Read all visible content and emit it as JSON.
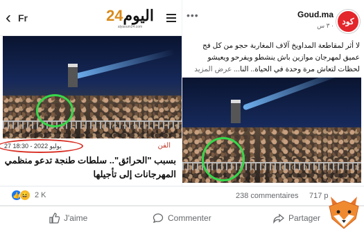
{
  "left_article": {
    "nav": {
      "back_icon": "chevron-left-icon",
      "lang": "Fr",
      "menu_icon": "hamburger-icon"
    },
    "logo": {
      "text_main": "اليوم",
      "text_num": "24",
      "tagline": "alyaoum24.com"
    },
    "date": "27 يوليو 2022 - 18:30",
    "category": "الفن",
    "headline": "بسبب \"الحرائق\".. سلطات طنجة تدعو منظمي المهرجانات إلى تأجيلها"
  },
  "right_post": {
    "page_name": "Goud.ma",
    "avatar_text": "كود",
    "time": "٣ س ·",
    "more_icon": "more-dots-icon",
    "text": "لا أثر لمقاطعة المداويخ آلاف المغاربة حجو من كل فج عميق لمهرجان موازين باش ينشطو ويفرحو ويعيشو لحظات لتعاش مرة وحدة في الحياة.. النا...",
    "see_more": "عرض المزيد"
  },
  "stats": {
    "reaction_count": "2 K",
    "comments": "238 commentaires",
    "shares": "717 p"
  },
  "actions": {
    "like": "J'aime",
    "comment": "Commenter",
    "share": "Partager"
  },
  "colors": {
    "accent": "#1877f2",
    "annotation_green": "#36d94a",
    "annotation_red": "#d93025",
    "brand_red": "#e3262b"
  }
}
